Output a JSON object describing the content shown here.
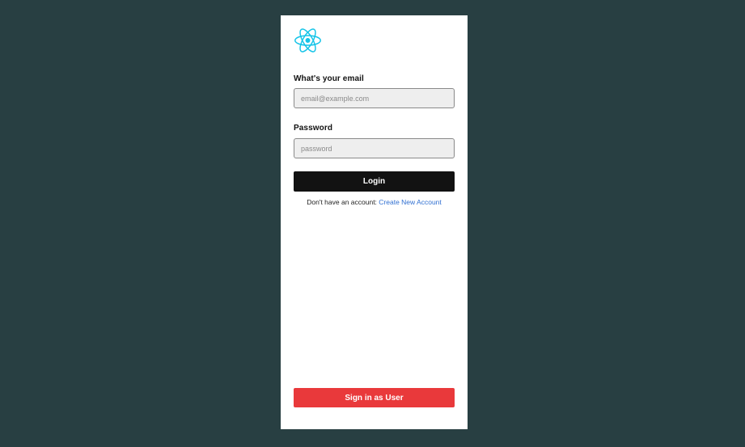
{
  "theme": {
    "page_background": "#283f42",
    "card_background": "#ffffff",
    "logo_color": "#15c4e8",
    "login_button_color": "#121212",
    "user_button_color": "#e9393b",
    "link_color": "#2f6fd1"
  },
  "logo": {
    "icon": "react-atom-icon"
  },
  "login_form": {
    "email_label": "What's your email",
    "email_value": "",
    "email_placeholder": "email@example.com",
    "password_label": "Password",
    "password_value": "",
    "password_placeholder": "password",
    "login_label": "Login"
  },
  "signup": {
    "prompt": "Don't have an account: ",
    "link_label": "Create New Account"
  },
  "footer": {
    "user_signin_label": "Sign in as User"
  }
}
